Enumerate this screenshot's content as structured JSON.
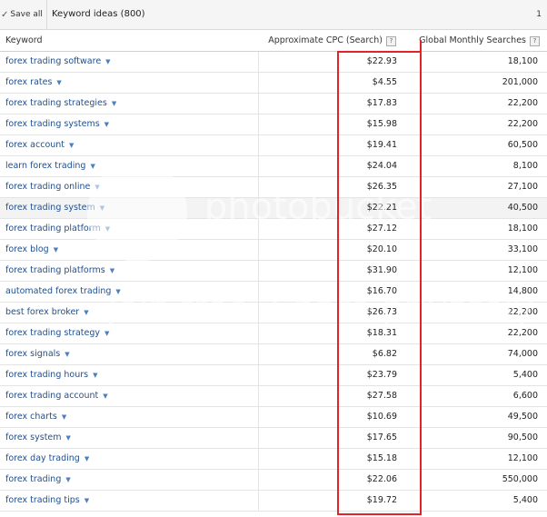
{
  "toolbar": {
    "save_all": "Save all",
    "title": "Keyword ideas (800)",
    "page": "1"
  },
  "columns": {
    "keyword": "Keyword",
    "cpc": "Approximate CPC (Search)",
    "gms": "Global Monthly Searches",
    "help": "?"
  },
  "rows": [
    {
      "keyword": "forex trading software",
      "cpc": "$22.93",
      "gms": "18,100"
    },
    {
      "keyword": "forex rates",
      "cpc": "$4.55",
      "gms": "201,000"
    },
    {
      "keyword": "forex trading strategies",
      "cpc": "$17.83",
      "gms": "22,200"
    },
    {
      "keyword": "forex trading systems",
      "cpc": "$15.98",
      "gms": "22,200"
    },
    {
      "keyword": "forex account",
      "cpc": "$19.41",
      "gms": "60,500"
    },
    {
      "keyword": "learn forex trading",
      "cpc": "$24.04",
      "gms": "8,100"
    },
    {
      "keyword": "forex trading online",
      "cpc": "$26.35",
      "gms": "27,100"
    },
    {
      "keyword": "forex trading system",
      "cpc": "$22.21",
      "gms": "40,500"
    },
    {
      "keyword": "forex trading platform",
      "cpc": "$27.12",
      "gms": "18,100"
    },
    {
      "keyword": "forex blog",
      "cpc": "$20.10",
      "gms": "33,100"
    },
    {
      "keyword": "forex trading platforms",
      "cpc": "$31.90",
      "gms": "12,100"
    },
    {
      "keyword": "automated forex trading",
      "cpc": "$16.70",
      "gms": "14,800"
    },
    {
      "keyword": "best forex broker",
      "cpc": "$26.73",
      "gms": "22,200"
    },
    {
      "keyword": "forex trading strategy",
      "cpc": "$18.31",
      "gms": "22,200"
    },
    {
      "keyword": "forex signals",
      "cpc": "$6.82",
      "gms": "74,000"
    },
    {
      "keyword": "forex trading hours",
      "cpc": "$23.79",
      "gms": "5,400"
    },
    {
      "keyword": "forex trading account",
      "cpc": "$27.58",
      "gms": "6,600"
    },
    {
      "keyword": "forex charts",
      "cpc": "$10.69",
      "gms": "49,500"
    },
    {
      "keyword": "forex system",
      "cpc": "$17.65",
      "gms": "90,500"
    },
    {
      "keyword": "forex day trading",
      "cpc": "$15.18",
      "gms": "12,100"
    },
    {
      "keyword": "forex trading",
      "cpc": "$22.06",
      "gms": "550,000"
    },
    {
      "keyword": "forex trading tips",
      "cpc": "$19.72",
      "gms": "5,400"
    }
  ],
  "highlighted_row": 7,
  "watermark": {
    "line1": "photobucket",
    "line2": "Join free. Share privately."
  },
  "colors": {
    "link": "#1f4f8f",
    "highlight_box": "#e2232b"
  }
}
